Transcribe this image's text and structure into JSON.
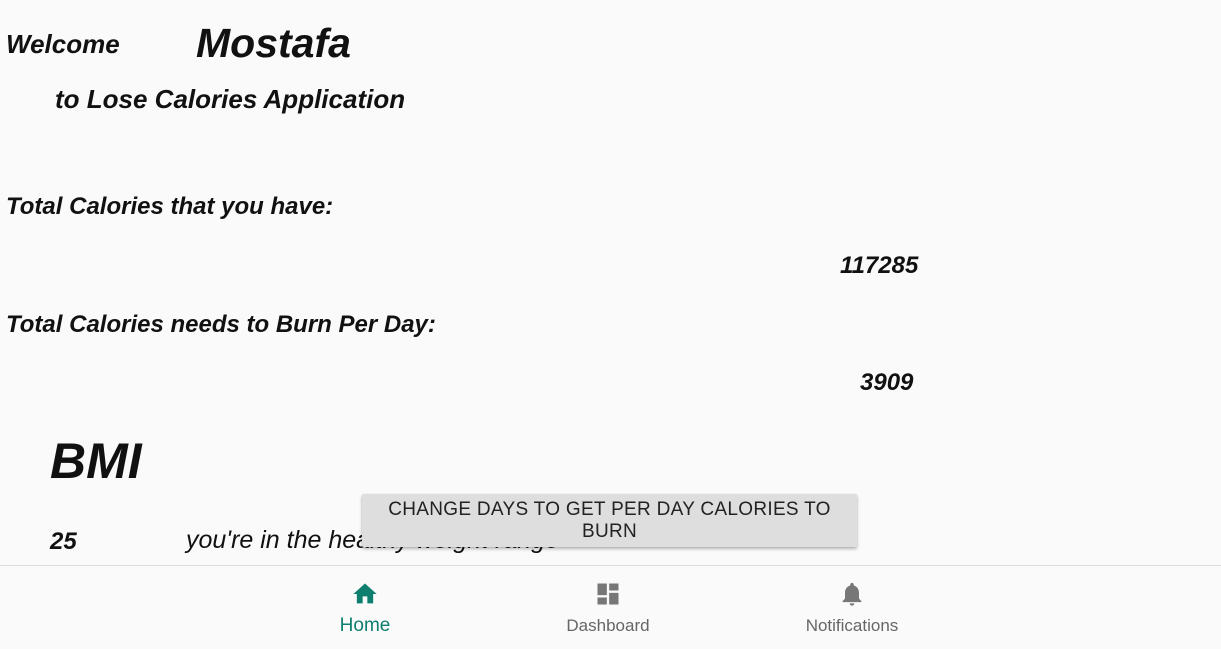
{
  "header": {
    "welcome": "Welcome",
    "username": "Mostafa",
    "subtitle": "to Lose Calories Application"
  },
  "calories": {
    "total_label": "Total Calories that you have:",
    "total_value": "117285",
    "per_day_label": "Total Calories needs to Burn Per Day:",
    "per_day_value": "3909"
  },
  "bmi": {
    "title": "BMI",
    "value": "25",
    "status": "you're in the healthy weight range"
  },
  "change_button": {
    "label": "CHANGE DAYS TO GET PER DAY CALORIES TO BURN"
  },
  "bottom_nav": {
    "items": [
      {
        "label": "Home",
        "icon": "home-icon",
        "active": true
      },
      {
        "label": "Dashboard",
        "icon": "dashboard-icon",
        "active": false
      },
      {
        "label": "Notifications",
        "icon": "bell-icon",
        "active": false
      }
    ]
  },
  "colors": {
    "accent": "#0e7f6e",
    "inactive": "#666666",
    "background": "#fafafa",
    "button": "#dedede"
  }
}
